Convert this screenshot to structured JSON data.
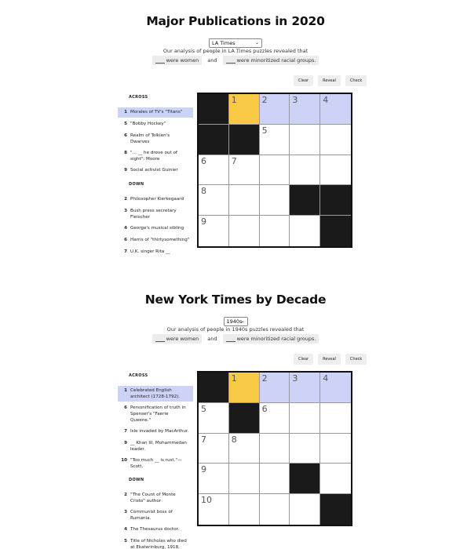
{
  "sections": [
    {
      "title": "Major Publications in 2020",
      "select_value": "LA Times",
      "analysis": "Our analysis of people in LA Times puzzles revealed that",
      "answer_a": "were women",
      "and": "and",
      "answer_b": "were minoritized racial groups.",
      "buttons": [
        "Clear",
        "Reveal",
        "Check"
      ],
      "across_label": "ACROSS",
      "down_label": "DOWN",
      "across": [
        {
          "num": "1",
          "text": "Morales of TV's \"Titans\"",
          "active": true
        },
        {
          "num": "5",
          "text": "\"Bobby Hockey\""
        },
        {
          "num": "6",
          "text": "Realm of Tolkien's Dwarves"
        },
        {
          "num": "8",
          "text": "\"... __ he drove out of sight\": Moore"
        },
        {
          "num": "9",
          "text": "Social activist Guinier"
        }
      ],
      "down": [
        {
          "num": "2",
          "text": "Philosopher Kierkegaard"
        },
        {
          "num": "3",
          "text": "Bush press secretary Fleischer"
        },
        {
          "num": "4",
          "text": "George's musical sibling"
        },
        {
          "num": "6",
          "text": "Harris of \"thirtysomething\""
        },
        {
          "num": "7",
          "text": "U.K. singer Rita __"
        }
      ],
      "grid": [
        [
          "B",
          "S1",
          "H2",
          "H3",
          "H4"
        ],
        [
          "B",
          "B",
          "5",
          "",
          ""
        ],
        [
          "6",
          "7",
          "",
          "",
          ""
        ],
        [
          "8",
          "",
          "",
          "B",
          "B"
        ],
        [
          "9",
          "",
          "",
          "",
          "B"
        ]
      ]
    },
    {
      "title": "New York Times by Decade",
      "select_value": "1940s",
      "analysis": "Our analysis of people in 1940s puzzles revealed that",
      "answer_a": "were women",
      "and": "and",
      "answer_b": "were minoritized racial groups.",
      "buttons": [
        "Clear",
        "Reveal",
        "Check"
      ],
      "across_label": "ACROSS",
      "down_label": "DOWN",
      "across": [
        {
          "num": "1",
          "text": "Celebrated English architect (1728-1792).",
          "active": true
        },
        {
          "num": "6",
          "text": "Personification of truth in Spenser's \"Faerie Queene.\""
        },
        {
          "num": "7",
          "text": "Isle invaded by MacArthur."
        },
        {
          "num": "9",
          "text": "__ Khan III, Mohammedan leader."
        },
        {
          "num": "10",
          "text": "\"Too much __ is rust.\"—Scott."
        }
      ],
      "down": [
        {
          "num": "2",
          "text": "\"The Count of Monte Cristo\" author"
        },
        {
          "num": "3",
          "text": "Communist boss of Rumania."
        },
        {
          "num": "4",
          "text": "The Thesaurus doctor."
        },
        {
          "num": "5",
          "text": "Title of Nicholas who died at Ekaterinburg, 1918."
        }
      ],
      "grid": [
        [
          "B",
          "S1",
          "H2",
          "H3",
          "H4"
        ],
        [
          "5",
          "B",
          "6",
          "",
          ""
        ],
        [
          "7",
          "8",
          "",
          "",
          ""
        ],
        [
          "9",
          "",
          "",
          "B",
          ""
        ],
        [
          "10",
          "",
          "",
          "",
          "B"
        ]
      ]
    }
  ]
}
